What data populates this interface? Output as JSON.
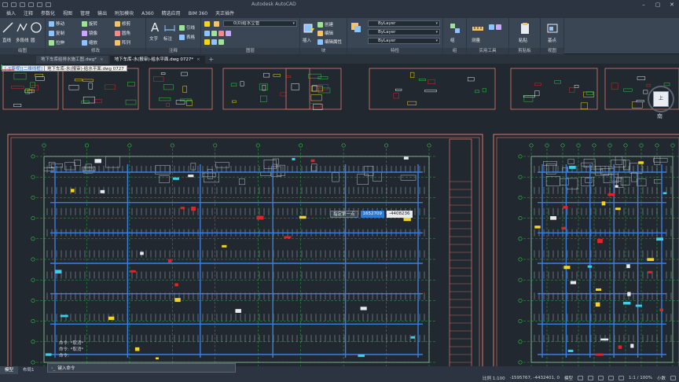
{
  "app": {
    "title": "Autodesk AutoCAD"
  },
  "menu_tabs": [
    "插入",
    "注释",
    "参数化",
    "视图",
    "管理",
    "输出",
    "附加模块",
    "A360",
    "精选应用",
    "BIM 360",
    "天正插件"
  ],
  "ribbon": {
    "panels": [
      "绘图",
      "修改",
      "注释",
      "图层",
      "块",
      "特性",
      "组",
      "实用工具",
      "剪贴板",
      "视图"
    ],
    "draw": {
      "tools": [
        "直线",
        "多段线",
        "圆",
        "圆弧"
      ]
    },
    "modify": {
      "tools": [
        "移动",
        "旋转",
        "修剪",
        "复制",
        "镜像",
        "圆角",
        "拉伸",
        "缩放",
        "阵列"
      ]
    },
    "annotation": {
      "tools": [
        "文字",
        "标注",
        "引线",
        "表格"
      ]
    },
    "layer": {
      "current": "0(0)给水立管"
    },
    "block": {
      "tools": [
        "插入",
        "创建",
        "编辑",
        "编辑属性"
      ]
    },
    "properties": {
      "color": "ByLayer",
      "linetype": "ByLayer",
      "lineweight": "ByLayer"
    },
    "buttons_right": [
      "组",
      "测量",
      "粘贴",
      "基点"
    ]
  },
  "file_tabs": [
    {
      "label": "地下车库给排水施工图.dwg*",
      "active": false
    },
    {
      "label": "地下车库-水(报审)-给水平面.dwg 0727*",
      "active": true
    }
  ],
  "viewport": {
    "label": "[-][俯视][二维线框]",
    "file_label": "地下车库-水(报审)-给水平面.dwg 0727"
  },
  "viewcube": {
    "face": "上",
    "compass": "南"
  },
  "coord_tip": {
    "label": "指定第一点",
    "x": "1652709",
    "y": "-4408236"
  },
  "cmd_history": [
    "命令: *取消*",
    "命令: *取消*",
    "命令:"
  ],
  "cmdline": {
    "prompt": "键入命令"
  },
  "layout_tabs": [
    {
      "label": "模型",
      "active": true
    },
    {
      "label": "布局1",
      "active": false
    }
  ],
  "statusbar": {
    "scale": "比例 1:100",
    "coords": "-1595767, -4432401, 0",
    "model": "模型",
    "annoscale": "1:1 / 100%",
    "units": "小数"
  },
  "colors": {
    "canvas": "#212830",
    "ribbon": "#3b4654",
    "sheet_border": "#e07a6a",
    "pipe": "#3a7fe0",
    "grid": "#2ecc40",
    "wall": "#b8c2cc",
    "accent_yellow": "#f3d51f",
    "accent_red": "#e0242a"
  }
}
